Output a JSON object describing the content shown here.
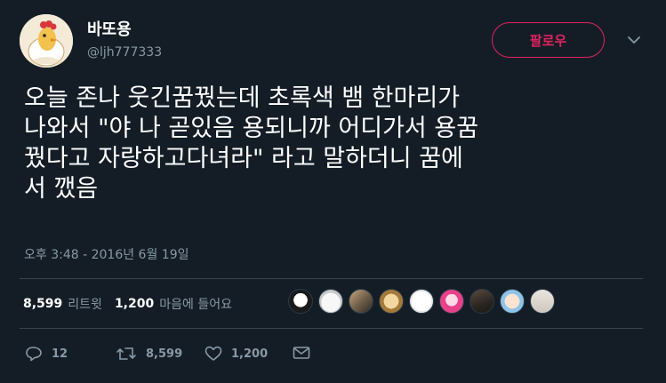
{
  "user": {
    "display_name": "바또용",
    "handle": "@ljh777333",
    "avatar_icon": "chicken-avatar-icon"
  },
  "header": {
    "follow_label": "팔로우",
    "menu_icon": "chevron-down-icon"
  },
  "tweet": {
    "text": "오늘 존나 웃긴꿈꿨는데 초록색 뱀 한마리가\n나와서 \"야 나 곧있음 용되니까 어디가서 용꿈\n꿨다고 자랑하고다녀라\" 라고 말하더니 꿈에\n서 깼음",
    "timestamp": "오후 3:48 - 2016년 6월 19일"
  },
  "stats": {
    "retweets_count": "8,599",
    "retweets_label": "리트윗",
    "likes_count": "1,200",
    "likes_label": "마음에 들어요",
    "liker_avatars": [
      "liker-avatar-1",
      "liker-avatar-2",
      "liker-avatar-3",
      "liker-avatar-4",
      "liker-avatar-5",
      "liker-avatar-6",
      "liker-avatar-7",
      "liker-avatar-8",
      "liker-avatar-9"
    ]
  },
  "actions": {
    "reply_count": "12",
    "retweet_count": "8,599",
    "like_count": "1,200",
    "icons": [
      "reply-icon",
      "retweet-icon",
      "heart-icon",
      "message-icon"
    ]
  },
  "colors": {
    "background": "#141d26",
    "follow_accent": "#e0245e",
    "secondary_text": "#8899a6",
    "divider": "#38444d"
  }
}
